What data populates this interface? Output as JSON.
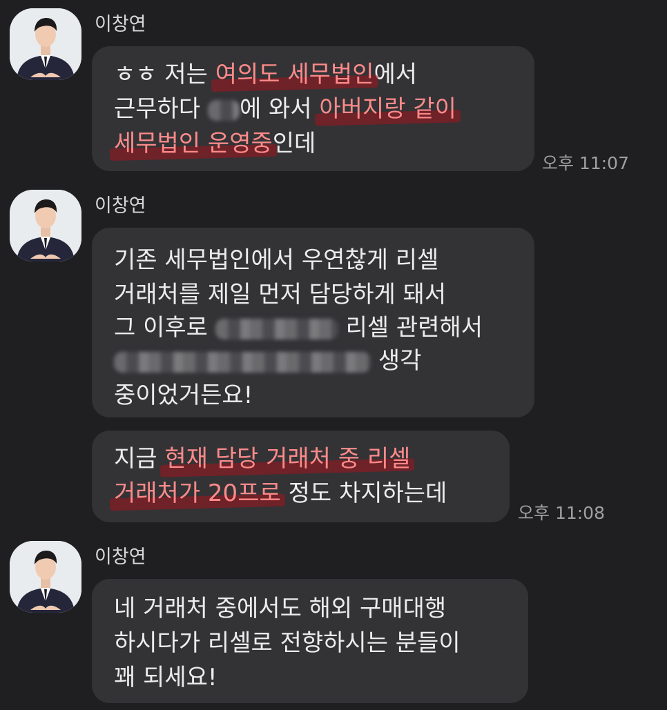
{
  "contact": {
    "name": "이창연"
  },
  "messages": [
    {
      "lines": [
        {
          "pre": "ㅎㅎ 저는 ",
          "hl": "여의도 세무법인",
          "post": "에서"
        },
        {
          "pre": "근무하다 ",
          "post": "에 와서 ",
          "hl": "아버지랑 같이"
        },
        {
          "hl": "세무법인 운영중",
          "post": "인데"
        }
      ],
      "time": "오후 11:07"
    },
    {
      "lines": [
        {
          "pre": "기존 세무법인에서 우연찮게 리셀"
        },
        {
          "pre": "거래처를 제일 먼저 담당하게 돼서"
        },
        {
          "pre": "그 이후로 ",
          "post": "리셀 관련해서"
        },
        {
          "post": "생각"
        },
        {
          "pre": "중이었거든요!"
        }
      ]
    },
    {
      "lines": [
        {
          "pre": "지금 ",
          "hl": "현재 담당 거래처 중 리셀"
        },
        {
          "hl": "거래처가 20프로",
          "post": " 정도 차지하는데"
        }
      ],
      "time": "오후 11:08"
    },
    {
      "lines": [
        {
          "pre": "네 거래처 중에서도 해외 구매대행"
        },
        {
          "pre": "하시다가 리셀로 전향하시는 분들이"
        },
        {
          "pre": "꽤 되세요!"
        }
      ]
    }
  ]
}
